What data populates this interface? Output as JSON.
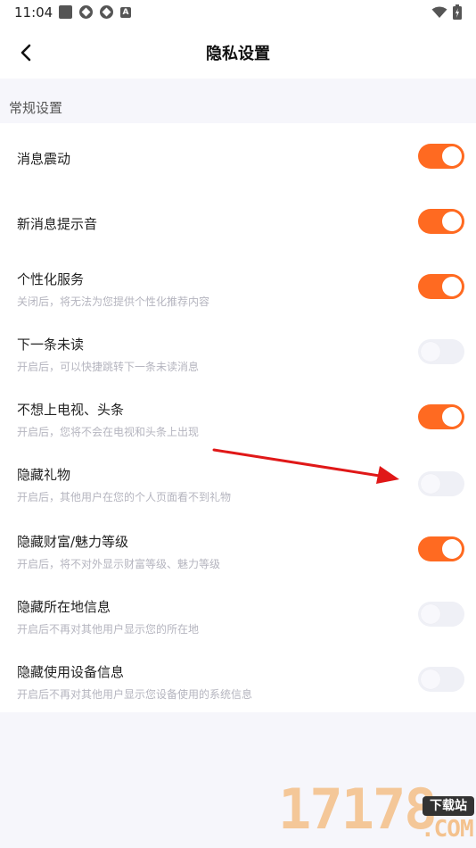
{
  "status_bar": {
    "time": "11:04",
    "icons": [
      "square-icon",
      "gear-icon",
      "gear-icon",
      "a-icon",
      "wifi-icon",
      "battery-icon"
    ]
  },
  "header": {
    "title": "隐私设置",
    "back_icon": "chevron-left-icon"
  },
  "section": {
    "label": "常规设置"
  },
  "settings": [
    {
      "title": "消息震动",
      "description": "",
      "enabled": true
    },
    {
      "title": "新消息提示音",
      "description": "",
      "enabled": true
    },
    {
      "title": "个性化服务",
      "description": "关闭后，将无法为您提供个性化推荐内容",
      "enabled": true
    },
    {
      "title": "下一条未读",
      "description": "开启后，可以快捷跳转下一条未读消息",
      "enabled": false
    },
    {
      "title": "不想上电视、头条",
      "description": "开启后，您将不会在电视和头条上出现",
      "enabled": true
    },
    {
      "title": "隐藏礼物",
      "description": "开启后，其他用户在您的个人页面看不到礼物",
      "enabled": false
    },
    {
      "title": "隐藏财富/魅力等级",
      "description": "开启后，将不对外显示财富等级、魅力等级",
      "enabled": true
    },
    {
      "title": "隐藏所在地信息",
      "description": "开启后不再对其他用户显示您的所在地",
      "enabled": false
    },
    {
      "title": "隐藏使用设备信息",
      "description": "开启后不再对其他用户显示您设备使用的系统信息",
      "enabled": false
    }
  ],
  "colors": {
    "accent": "#ff6a21",
    "toggle_off": "#eff0f6",
    "annotation_arrow": "#e01818"
  },
  "watermark": {
    "digits": "17178",
    "badge": "下载站",
    "suffix": ".COM"
  }
}
